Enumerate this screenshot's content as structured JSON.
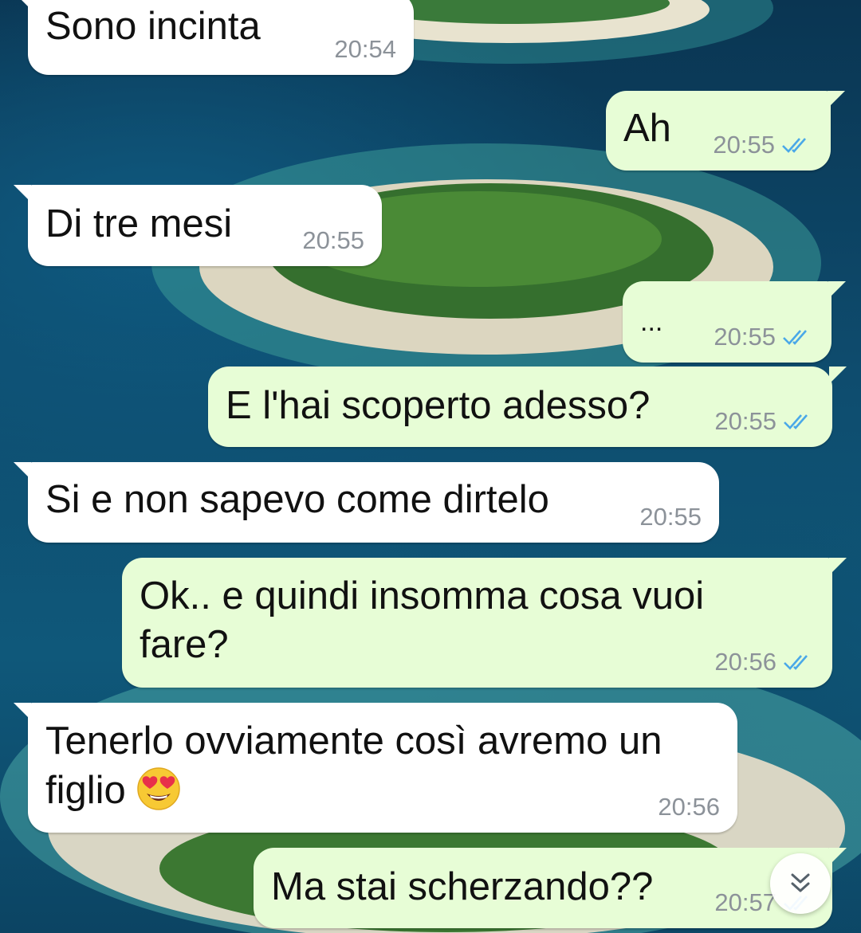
{
  "chat": {
    "messages": [
      {
        "direction": "incoming",
        "text": "Sono incinta",
        "time": "20:54"
      },
      {
        "direction": "outgoing",
        "text": "Ah",
        "time": "20:55",
        "status": "read"
      },
      {
        "direction": "incoming",
        "text": "Di tre mesi",
        "time": "20:55"
      },
      {
        "direction": "outgoing",
        "text": "...",
        "time": "20:55",
        "status": "read"
      },
      {
        "direction": "outgoing",
        "text": "E l'hai scoperto adesso?",
        "time": "20:55",
        "status": "read"
      },
      {
        "direction": "incoming",
        "text": "Si e non sapevo come dirtelo",
        "time": "20:55"
      },
      {
        "direction": "outgoing",
        "text_line1": "Ok.. e quindi insomma cosa vuoi",
        "text_line2": "fare?",
        "time": "20:56",
        "status": "read"
      },
      {
        "direction": "incoming",
        "text_line1": "Tenerlo ovviamente così avremo un",
        "text_line2": "figlio",
        "emoji": "smiling-face-with-heart-eyes",
        "time": "20:56"
      },
      {
        "direction": "outgoing",
        "text": "Ma stai scherzando??",
        "time": "20:57",
        "status": "read"
      }
    ]
  },
  "scroll_button": {
    "icon": "double-chevron-down-icon"
  },
  "colors": {
    "incoming_bubble": "#ffffff",
    "outgoing_bubble": "#e7fdd6",
    "timestamp": "#8c9299",
    "read_ticks": "#4aa8e8"
  }
}
